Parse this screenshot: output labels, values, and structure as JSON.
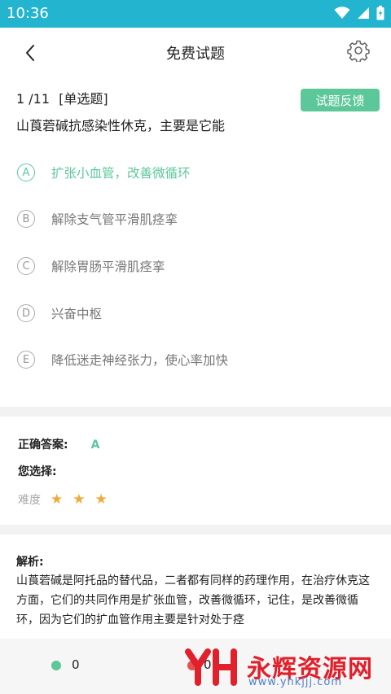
{
  "status_bar": {
    "time": "10:36",
    "bg_color": "#23b5cf"
  },
  "header": {
    "title": "免费试题",
    "back_icon": "chevron-left-icon",
    "settings_icon": "gear-icon"
  },
  "question": {
    "progress": "1 /11",
    "type": "[单选题]",
    "feedback_label": "试题反馈",
    "text": "山莨菪碱抗感染性休克，主要是它能",
    "options": [
      {
        "letter": "A",
        "text": "扩张小血管，改善微循环",
        "correct": true
      },
      {
        "letter": "B",
        "text": "解除支气管平滑肌痉挛",
        "correct": false
      },
      {
        "letter": "C",
        "text": "解除胃肠平滑肌痉挛",
        "correct": false
      },
      {
        "letter": "D",
        "text": "兴奋中枢",
        "correct": false
      },
      {
        "letter": "E",
        "text": "降低迷走神经张力，使心率加快",
        "correct": false
      }
    ]
  },
  "result": {
    "correct_label": "正确答案:",
    "correct_value": "A",
    "your_choice_label": "您选择:",
    "difficulty_label": "难度",
    "difficulty_stars": 3
  },
  "analysis": {
    "title": "解析:",
    "text": "山莨菪碱是阿托品的替代品，二者都有同样的药理作用，在治疗休克这方面，它们的共同作用是扩张血管，改善微循环，记住，是改善微循环，因为它们的扩血管作用主要是针对处于痉"
  },
  "bottom_bar": {
    "correct_count": "0",
    "wrong_count": "0"
  },
  "watermark": {
    "text": "永辉资源网",
    "url": "www.yhkjjj.com"
  },
  "colors": {
    "accent_green": "#5cc89a",
    "star": "#f0a93a",
    "wrong_red": "#e85050"
  }
}
